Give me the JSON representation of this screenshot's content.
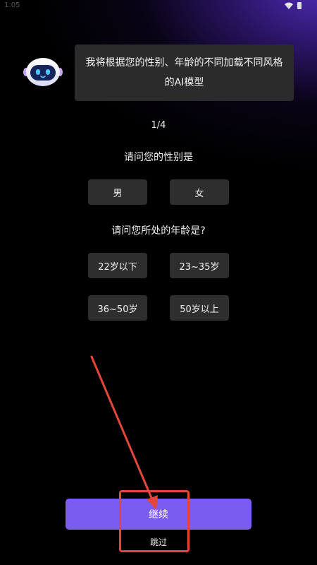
{
  "status_bar": {
    "time": "1:05",
    "icons": [
      "wifi-icon",
      "battery-icon"
    ]
  },
  "assistant": {
    "avatar_icon": "robot-icon",
    "message": "我将根据您的性别、年龄的不同加载不同风格的AI模型"
  },
  "step_indicator": "1/4",
  "gender_question": {
    "label": "请问您的性别是",
    "options": [
      "男",
      "女"
    ]
  },
  "age_question": {
    "label": "请问您所处的年龄是?",
    "options": [
      "22岁以下",
      "23~35岁",
      "36~50岁",
      "50岁以上"
    ]
  },
  "actions": {
    "continue_label": "继续",
    "skip_label": "跳过"
  },
  "colors": {
    "accent": "#7b5cf0",
    "annotation": "#e4473a",
    "option_bg": "#2e2e2e",
    "bubble_bg": "#2b2b2b"
  }
}
